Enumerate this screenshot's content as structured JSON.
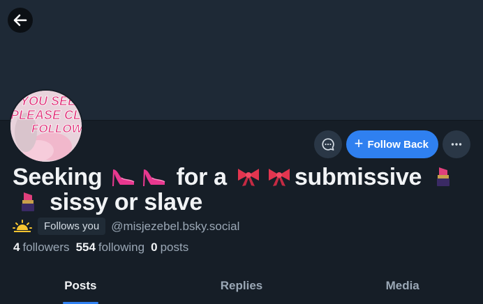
{
  "profile": {
    "name_parts": [
      "Seeking",
      "for a",
      "submissive",
      "sissy or slave"
    ],
    "avatar_text": [
      "YOU SEE",
      "PLEASE CL",
      "FOLLOW"
    ],
    "follows_you": "Follows you",
    "handle": "@misjezebel.bsky.social",
    "stats": {
      "followers_count": "4",
      "followers_label": "followers",
      "following_count": "554",
      "following_label": "following",
      "posts_count": "0",
      "posts_label": "posts"
    }
  },
  "actions": {
    "follow_back_label": "Follow Back"
  },
  "tabs": [
    {
      "label": "Posts",
      "active": true
    },
    {
      "label": "Replies",
      "active": false
    },
    {
      "label": "Media",
      "active": false
    }
  ],
  "icons": {
    "back": "arrow-left-icon",
    "message": "chat-bubble-icon",
    "more": "ellipsis-icon",
    "emoji": [
      "high-heel-icon",
      "ribbon-icon",
      "lipstick-icon",
      "sunrise-icon"
    ]
  },
  "colors": {
    "accent": "#2f80f0",
    "background": "#161e27",
    "banner": "#1e2936"
  }
}
